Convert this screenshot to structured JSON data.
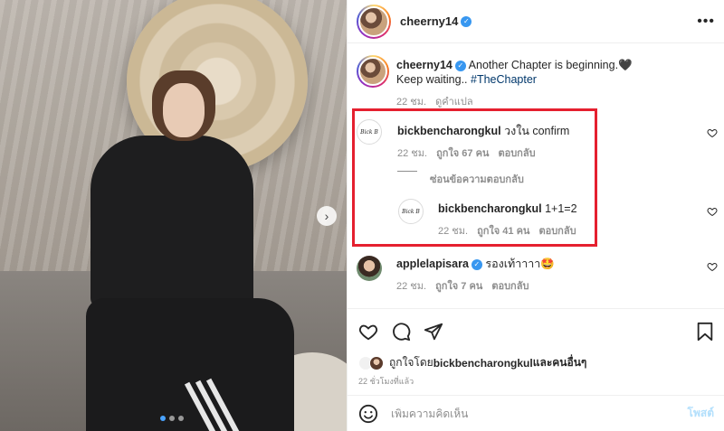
{
  "post": {
    "author": "cheerny14",
    "verified": true,
    "more_icon": "more-horizontal-icon"
  },
  "caption": {
    "author": "cheerny14",
    "line1": "Another Chapter is beginning.🖤",
    "line2_prefix": "Keep waiting.. ",
    "hashtag": "#TheChapter",
    "time": "22 ชม.",
    "translate": "ดูคำแปล"
  },
  "comments": [
    {
      "author": "bickbencharongkul",
      "text": "วงใน confirm",
      "time": "22 ชม.",
      "likes": "ถูกใจ 67 คน",
      "reply": "ตอบกลับ",
      "hide_replies": "ซ่อนข้อความตอบกลับ",
      "replies": [
        {
          "author": "bickbencharongkul",
          "text": "1+1=2",
          "time": "22 ชม.",
          "likes": "ถูกใจ 41 คน",
          "reply": "ตอบกลับ"
        }
      ]
    },
    {
      "author": "applelapisara",
      "verified": true,
      "text": "รองเท้าาาา🤩",
      "time": "22 ชม.",
      "likes": "ถูกใจ 7 คน",
      "reply": "ตอบกลับ"
    }
  ],
  "liked_by": {
    "prefix": "ถูกใจโดย ",
    "user": "bickbencharongkul",
    "suffix": " และคนอื่นๆ",
    "ago": "22 ชั่วโมงที่แล้ว"
  },
  "add_comment": {
    "placeholder": "เพิ่มความคิดเห็น",
    "post_label": "โพสต์"
  },
  "colors": {
    "highlight": "#e5202f",
    "verified": "#3897f0",
    "hashtag": "#00376b",
    "post_button": "#b2dffc"
  }
}
